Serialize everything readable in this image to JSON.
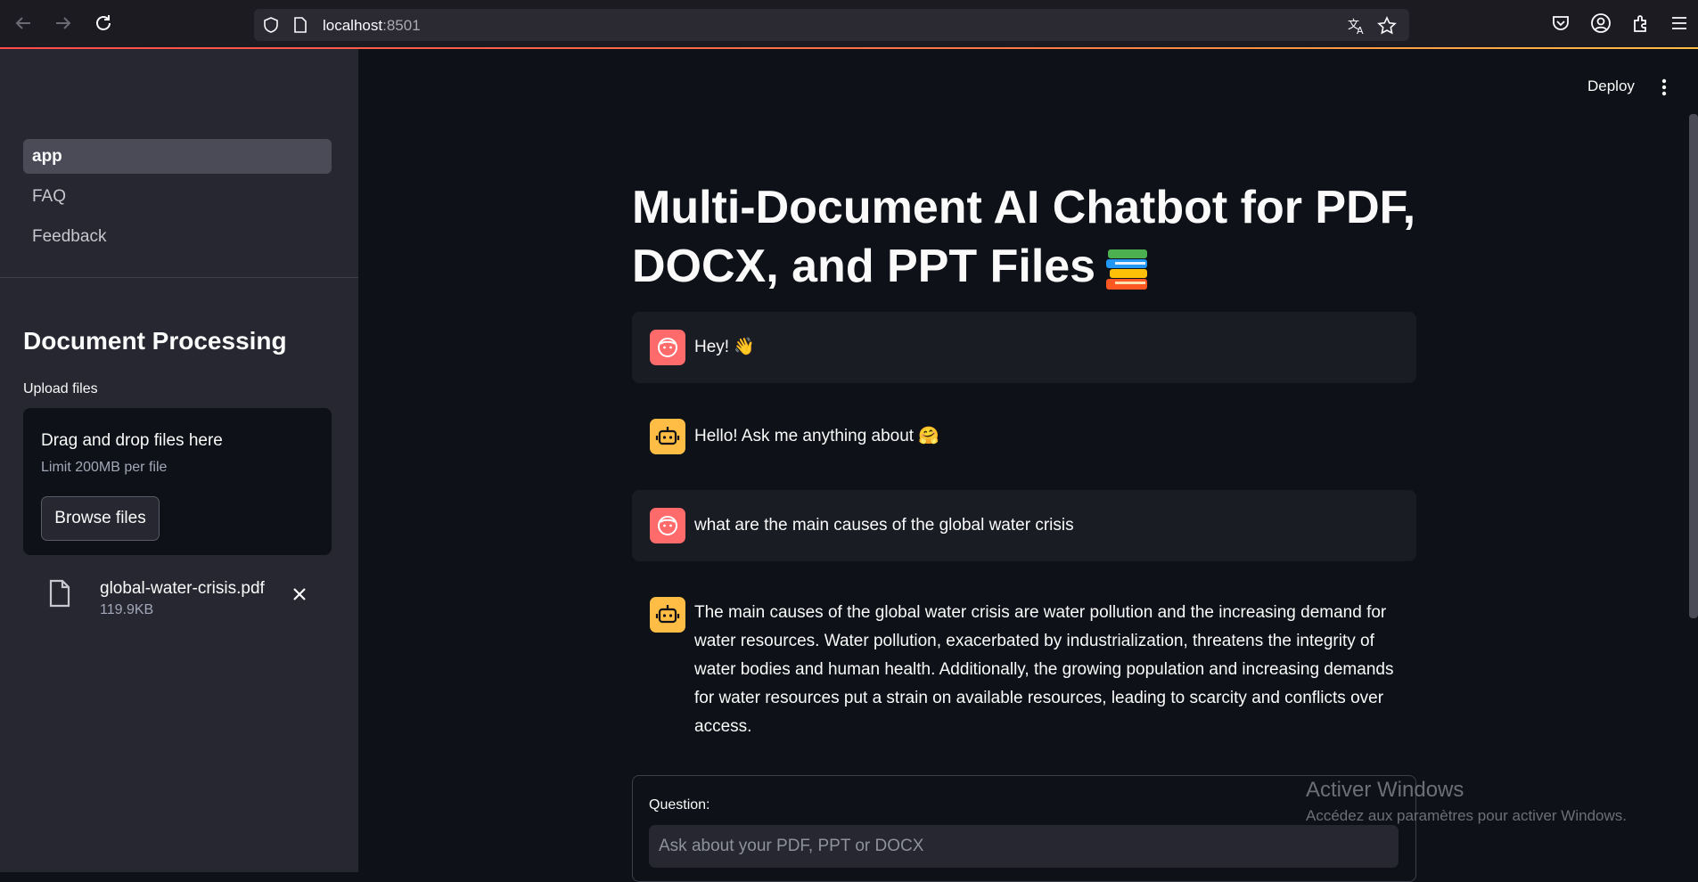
{
  "browser": {
    "url_host": "localhost",
    "url_port": ":8501"
  },
  "sidebar": {
    "nav": [
      {
        "label": "app",
        "active": true
      },
      {
        "label": "FAQ",
        "active": false
      },
      {
        "label": "Feedback",
        "active": false
      }
    ],
    "section_title": "Document Processing",
    "upload_label": "Upload files",
    "dropzone": {
      "main": "Drag and drop files here",
      "limit": "Limit 200MB per file",
      "browse_label": "Browse files"
    },
    "file": {
      "name": "global-water-crisis.pdf",
      "size": "119.9KB"
    }
  },
  "header": {
    "deploy_label": "Deploy"
  },
  "main": {
    "title_line1": "Multi-Document AI Chatbot for PDF,",
    "title_line2": "DOCX, and PPT Files",
    "messages": [
      {
        "role": "user",
        "text": "Hey! 👋"
      },
      {
        "role": "assistant",
        "text": "Hello! Ask me anything about 🤗"
      },
      {
        "role": "user",
        "text": "what are the main causes of the global water crisis"
      },
      {
        "role": "assistant",
        "lines": [
          "The main causes of the global water crisis are water pollution and the increasing demand for",
          "water resources. Water pollution, exacerbated by industrialization, threatens the integrity of",
          "water bodies and human health. Additionally, the growing population and increasing demands",
          "for water resources put a strain on available resources, leading to scarcity and conflicts over",
          "access."
        ]
      }
    ],
    "question": {
      "label": "Question:",
      "placeholder": "Ask about your PDF, PPT or DOCX"
    }
  },
  "watermark": {
    "title": "Activer Windows",
    "subtitle": "Accédez aux paramètres pour activer Windows."
  },
  "colors": {
    "user_avatar": "#ff6b6b",
    "bot_avatar": "#ffbd45",
    "accent": "#ff4b4b"
  },
  "icons": [
    "back-icon",
    "forward-icon",
    "reload-icon",
    "shield-icon",
    "page-icon",
    "translate-icon",
    "star-icon",
    "pocket-icon",
    "account-icon",
    "extensions-icon",
    "menu-icon",
    "file-icon",
    "close-icon",
    "kebab-icon",
    "books-emoji",
    "user-avatar-icon",
    "bot-avatar-icon"
  ]
}
